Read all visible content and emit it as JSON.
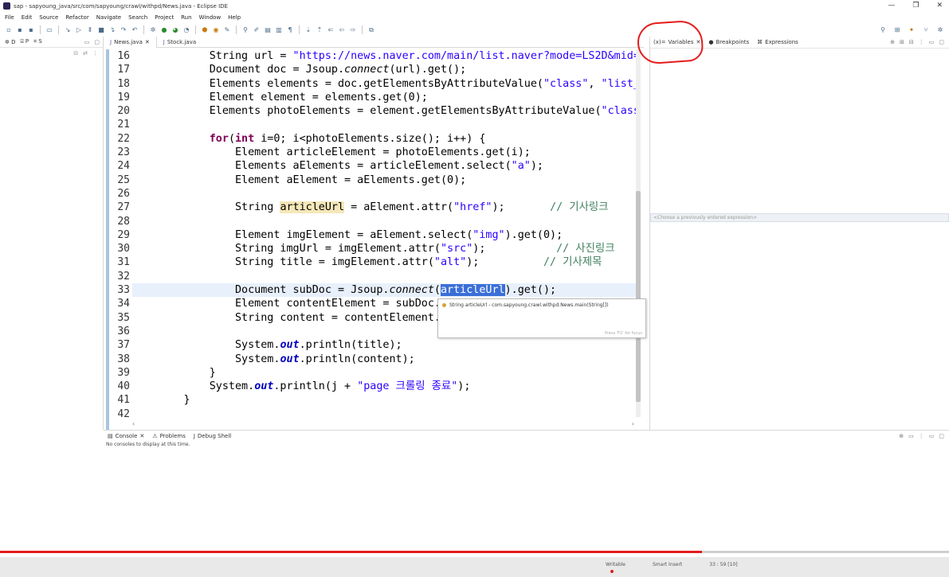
{
  "window": {
    "title": "sap - sapyoung_java/src/com/sapyoung/crawl/withpd/News.java - Eclipse IDE",
    "controls": [
      "—",
      "❐",
      "✕"
    ]
  },
  "menu": [
    "File",
    "Edit",
    "Source",
    "Refactor",
    "Navigate",
    "Search",
    "Project",
    "Run",
    "Window",
    "Help"
  ],
  "left_view": {
    "tabs": [
      "D",
      "P",
      "S"
    ]
  },
  "editor": {
    "tabs": [
      {
        "label": "News.java",
        "active": true
      },
      {
        "label": "Stock.java",
        "active": false
      }
    ],
    "line_numbers": [
      "16",
      "17",
      "18",
      "19",
      "20",
      "21",
      "22",
      "23",
      "24",
      "25",
      "26",
      "27",
      "28",
      "29",
      "30",
      "31",
      "32",
      "33",
      "34",
      "35",
      "36",
      "37",
      "38",
      "39",
      "40",
      "41",
      "42"
    ],
    "lines": {
      "l16": {
        "a": "            String url = ",
        "b": "\"https://news.naver.com/main/list.naver?mode=LS2D&mid=s"
      },
      "l17": {
        "a": "            Document doc = Jsoup.",
        "b": "connect",
        "c": "(url).get();"
      },
      "l18": {
        "a": "            Elements elements = doc.getElementsByAttributeValue(",
        "b": "\"class\"",
        "c": ", ",
        "d": "\"list_"
      },
      "l19": {
        "a": "            Element element = elements.get(0);"
      },
      "l20": {
        "a": "            Elements photoElements = element.getElementsByAttributeValue(",
        "b": "\"class"
      },
      "l22": {
        "kw1": "for",
        "a": "(",
        "kw2": "int",
        "b": " i=0; i<photoElements.size(); i++) {"
      },
      "l23": {
        "a": "                Element articleElement = photoElements.get(i);"
      },
      "l24": {
        "a": "                Elements aElements = articleElement.select(",
        "b": "\"a\"",
        "c": ");"
      },
      "l25": {
        "a": "                Element aElement = aElements.get(0);"
      },
      "l27": {
        "a": "                String ",
        "b": "articleUrl",
        "c": " = aElement.attr(",
        "d": "\"href\"",
        "e": ");       ",
        "f": "// 기사링크"
      },
      "l29": {
        "a": "                Element imgElement = aElement.select(",
        "b": "\"img\"",
        "c": ").get(0);"
      },
      "l30": {
        "a": "                String imgUrl = imgElement.attr(",
        "b": "\"src\"",
        "c": ");           ",
        "d": "// 사진링크"
      },
      "l31": {
        "a": "                String title = imgElement.attr(",
        "b": "\"alt\"",
        "c": ");          ",
        "d": "// 기사제목"
      },
      "l33": {
        "a": "                Document subDoc = Jsoup.",
        "b": "connect",
        "c": "(",
        "d": "articleUrl",
        "e": ").get();"
      },
      "l34": {
        "a": "                Element contentElement = subDoc."
      },
      "l35": {
        "a": "                String content = contentElement."
      },
      "l37": {
        "a": "                System.",
        "b": "out",
        "c": ".println(title);"
      },
      "l38": {
        "a": "                System.",
        "b": "out",
        "c": ".println(content);"
      },
      "l39": {
        "a": "            }"
      },
      "l40": {
        "a": "            System.",
        "b": "out",
        "c": ".println(j + ",
        "d": "\"page 크롤링 종료\"",
        "e": ");"
      },
      "l41": {
        "a": "        }"
      }
    },
    "tooltip": {
      "text": "String articleUrl - com.sapyoung.crawl.withpd.News.main(String[])",
      "hint": "Press 'F2' for focus"
    }
  },
  "debug": {
    "tabs": [
      "Variables",
      "Breakpoints",
      "Expressions"
    ],
    "expression_placeholder": "<Choose a previously entered expression>"
  },
  "console": {
    "tabs": [
      "Console",
      "Problems",
      "Debug Shell"
    ],
    "message": "No consoles to display at this time."
  },
  "status": {
    "writable": "Writable",
    "insert_mode": "Smart Insert",
    "position": "33 : 59 [10]"
  },
  "video_progress": 0.74,
  "colors": {
    "annotation_red": "#e41c1c",
    "selection_blue": "#3a6fd8",
    "keyword": "#7f0055",
    "string": "#2a00ff",
    "comment": "#3f7f5f"
  }
}
